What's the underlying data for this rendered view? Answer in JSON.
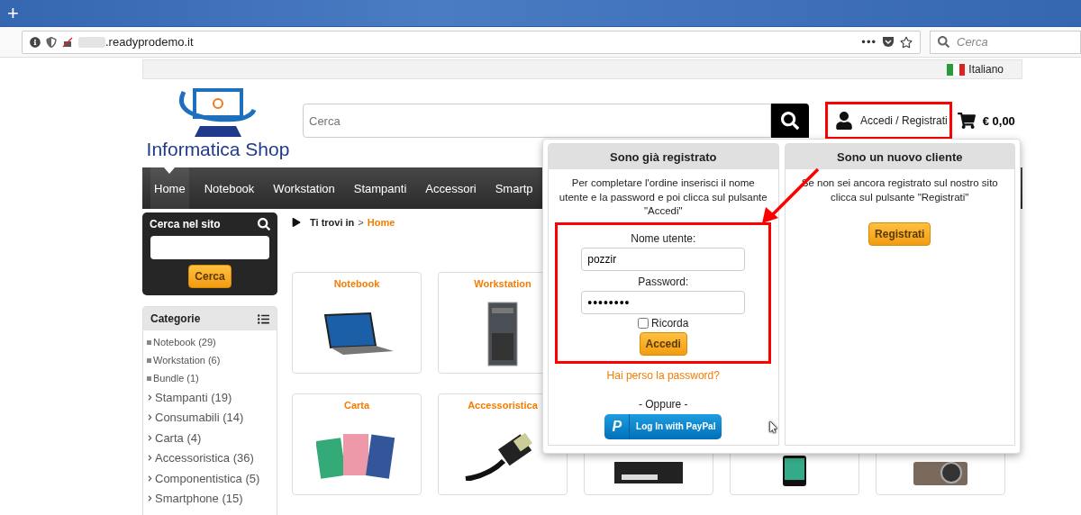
{
  "browser": {
    "new_tab": "+",
    "url_rest": ".readyprodemo.it",
    "menu_dots": "•••",
    "search_placeholder": "Cerca"
  },
  "language": {
    "label": "Italiano"
  },
  "header": {
    "logo_text": "Informatica Shop",
    "search_placeholder": "Cerca",
    "account_link": "Accedi / Registrati",
    "cart_total": "€ 0,00"
  },
  "nav": [
    {
      "label": "Home",
      "selected": true
    },
    {
      "label": "Notebook",
      "selected": false
    },
    {
      "label": "Workstation",
      "selected": false
    },
    {
      "label": "Stampanti",
      "selected": false
    },
    {
      "label": "Accessori",
      "selected": false
    },
    {
      "label": "Smartp",
      "selected": false
    }
  ],
  "site_search": {
    "title": "Cerca nel sito",
    "button": "Cerca"
  },
  "categories": {
    "title": "Categorie",
    "items": [
      {
        "label": "Notebook (29)",
        "kind": "sub"
      },
      {
        "label": "Workstation (6)",
        "kind": "sub"
      },
      {
        "label": "Bundle (1)",
        "kind": "sub"
      },
      {
        "label": "Stampanti (19)",
        "kind": "main"
      },
      {
        "label": "Consumabili (14)",
        "kind": "main"
      },
      {
        "label": "Carta (4)",
        "kind": "main"
      },
      {
        "label": "Accessoristica (36)",
        "kind": "main"
      },
      {
        "label": "Componentistica (5)",
        "kind": "main"
      },
      {
        "label": "Smartphone (15)",
        "kind": "main"
      }
    ]
  },
  "breadcrumb": {
    "label": "Ti trovi in",
    "separator": ">",
    "current": "Home"
  },
  "product_rows": [
    [
      {
        "title": "Notebook",
        "kind": "laptop"
      },
      {
        "title": "Workstation",
        "kind": "tower"
      }
    ],
    [
      {
        "title": "Carta",
        "kind": "paper"
      },
      {
        "title": "Accessoristica",
        "kind": "cable"
      },
      {
        "kind": "disk"
      },
      {
        "kind": "phone"
      },
      {
        "kind": "camera"
      }
    ]
  ],
  "login_dropdown": {
    "existing": {
      "title": "Sono già registrato",
      "text": "Per completare l'ordine inserisci il nome utente e la password e poi clicca sul pulsante \"Accedi\"",
      "username_label": "Nome utente:",
      "username_value": "pozzir",
      "password_label": "Password:",
      "password_value": "••••••••",
      "remember": {
        "label": "Ricorda",
        "checked": false
      },
      "submit": "Accedi",
      "lost_password": "Hai perso la password?",
      "or": "- Oppure -",
      "paypal_logo": "P",
      "paypal_button": "Log In with PayPal"
    },
    "new": {
      "title": "Sono un nuovo cliente",
      "text": "Se non sei ancora registrato sul nostro sito clicca sul pulsante \"Registrati\"",
      "button": "Registrati"
    }
  }
}
